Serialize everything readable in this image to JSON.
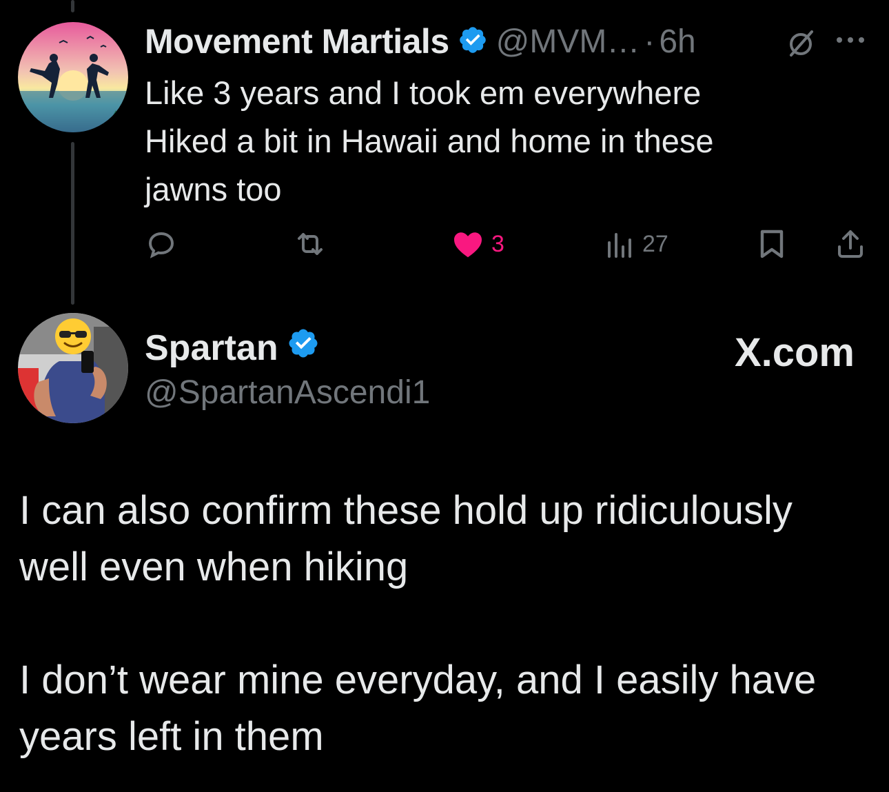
{
  "reply": {
    "display_name": "Movement Martials",
    "handle": "@MVM…",
    "separator": "·",
    "time": "6h",
    "text_lines": [
      "Like 3 years and I took em everywhere",
      "Hiked a bit in Hawaii and home in these",
      "jawns too"
    ],
    "likes": "3",
    "views": "27",
    "like_color": "#f91880"
  },
  "main": {
    "display_name": "Spartan",
    "handle": "@SpartanAscendi1",
    "brand": "X.com",
    "paragraphs": [
      [
        "I can also confirm these hold up ridiculously",
        "well even when hiking"
      ],
      [
        "I don’t wear mine everyday, and I easily have",
        "years left in them"
      ]
    ]
  },
  "colors": {
    "background": "#000000",
    "text": "#e7e9ea",
    "muted": "#71767b",
    "verified": "#1d9bf0"
  }
}
